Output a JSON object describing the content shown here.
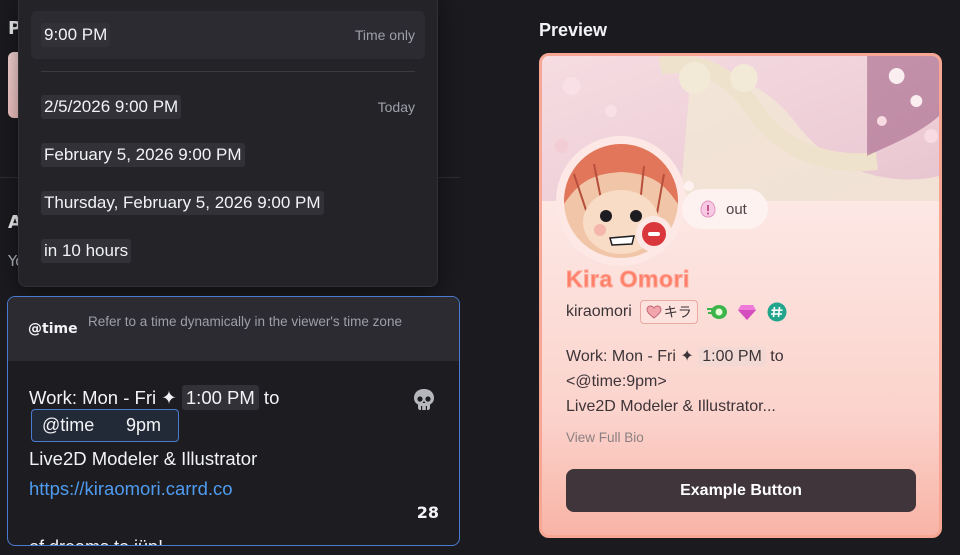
{
  "background": {
    "letter_p": "P",
    "letter_a": "A",
    "letter_y": "Yo"
  },
  "time_popup": {
    "options": [
      {
        "label": "9:00 PM",
        "note": "Time only"
      },
      {
        "label": "2/5/2026 9:00 PM",
        "note": "Today"
      },
      {
        "label": "February 5, 2026 9:00 PM",
        "note": ""
      },
      {
        "label": "Thursday, February 5, 2026 9:00 PM",
        "note": ""
      },
      {
        "label": "in 10 hours",
        "note": ""
      }
    ]
  },
  "editor": {
    "suggestion": {
      "tag": "@time",
      "description": "Refer to a time dynamically in the viewer's time zone"
    },
    "line1_prefix": "Work: Mon - Fri ✦ ",
    "line1_time": "1:00 PM",
    "line1_suffix": " to",
    "mention_tag": "@time",
    "mention_value": "9pm",
    "line3": "Live2D Modeler & Illustrator",
    "line4_link": "https://kiraomori.carrd.co",
    "line_cut": "of dreams to jüp!",
    "remaining_count": "28",
    "emoji_icon": "skull-icon"
  },
  "preview": {
    "title": "Preview",
    "status_bubble": "out",
    "display_name": "Kira Omori",
    "username": "kiraomori",
    "tag_text": "キラ",
    "bio_prefix": "Work: Mon - Fri ✦ ",
    "bio_time": "1:00 PM",
    "bio_suffix": " to",
    "bio_line2": "<@time:9pm>",
    "bio_line3": "Live2D Modeler & Illustrator...",
    "view_full_bio": "View Full Bio",
    "button_label": "Example Button",
    "status": "do-not-disturb",
    "colors": {
      "name": "#ff7e66",
      "card_border": "#f6a693",
      "button": "#3f353b"
    }
  }
}
